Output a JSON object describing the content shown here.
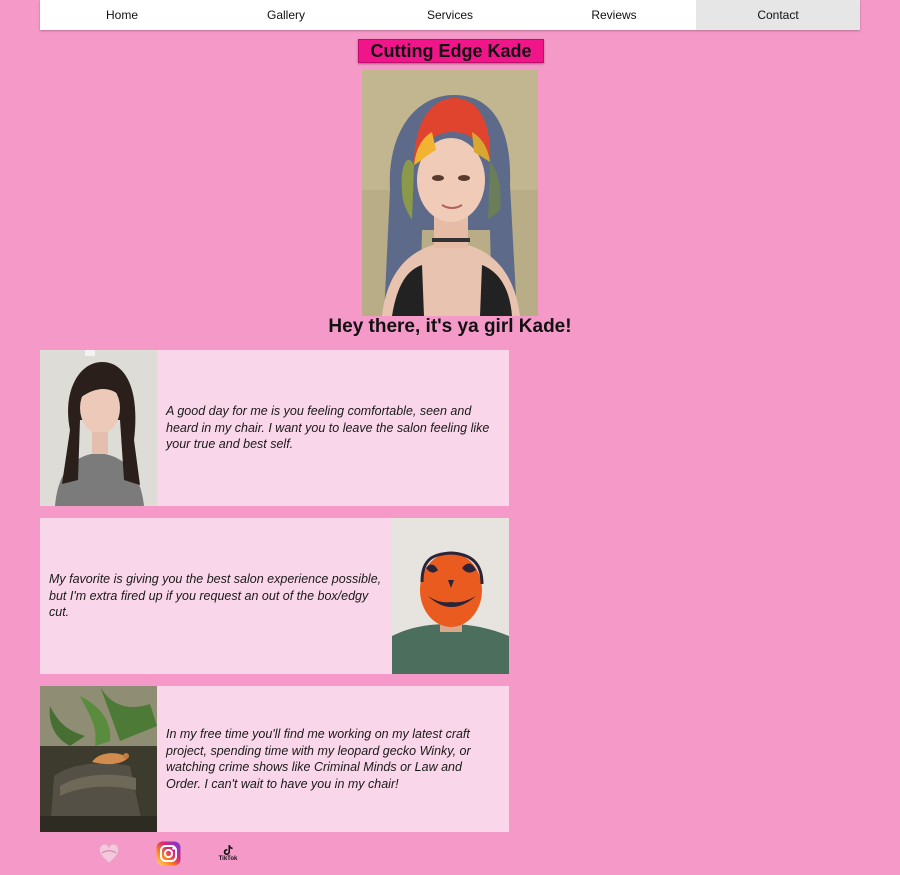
{
  "nav": {
    "items": [
      {
        "label": "Home"
      },
      {
        "label": "Gallery"
      },
      {
        "label": "Services"
      },
      {
        "label": "Reviews"
      },
      {
        "label": "Contact"
      }
    ],
    "active": "Contact"
  },
  "brand": {
    "title": "Cutting Edge Kade"
  },
  "hero": {
    "title": "Hey there, it's ya girl Kade!"
  },
  "cards": [
    {
      "text": "A good day for me is you feeling comfortable, seen and heard in my chair. I want you to leave the salon feeling like your true and best self."
    },
    {
      "text": "My favorite is giving you the best salon experience possible, but I'm extra fired up if you request an out of the box/edgy cut."
    },
    {
      "text": "In my free time you'll find me working on my latest craft project, spending time with my leopard gecko Winky, or watching crime shows like Criminal Minds or Law and Order. I can't wait to have you in my chair!"
    }
  ],
  "social": {
    "icons": [
      "vagaro-logo-icon",
      "instagram-icon",
      "tiktok-icon"
    ],
    "tiktok_label": "TikTok"
  },
  "colors": {
    "background": "#f599c9",
    "brand_fill": "#f0168a",
    "card_fill": "#f9d6e9",
    "nav_active": "#e6e6e6"
  }
}
